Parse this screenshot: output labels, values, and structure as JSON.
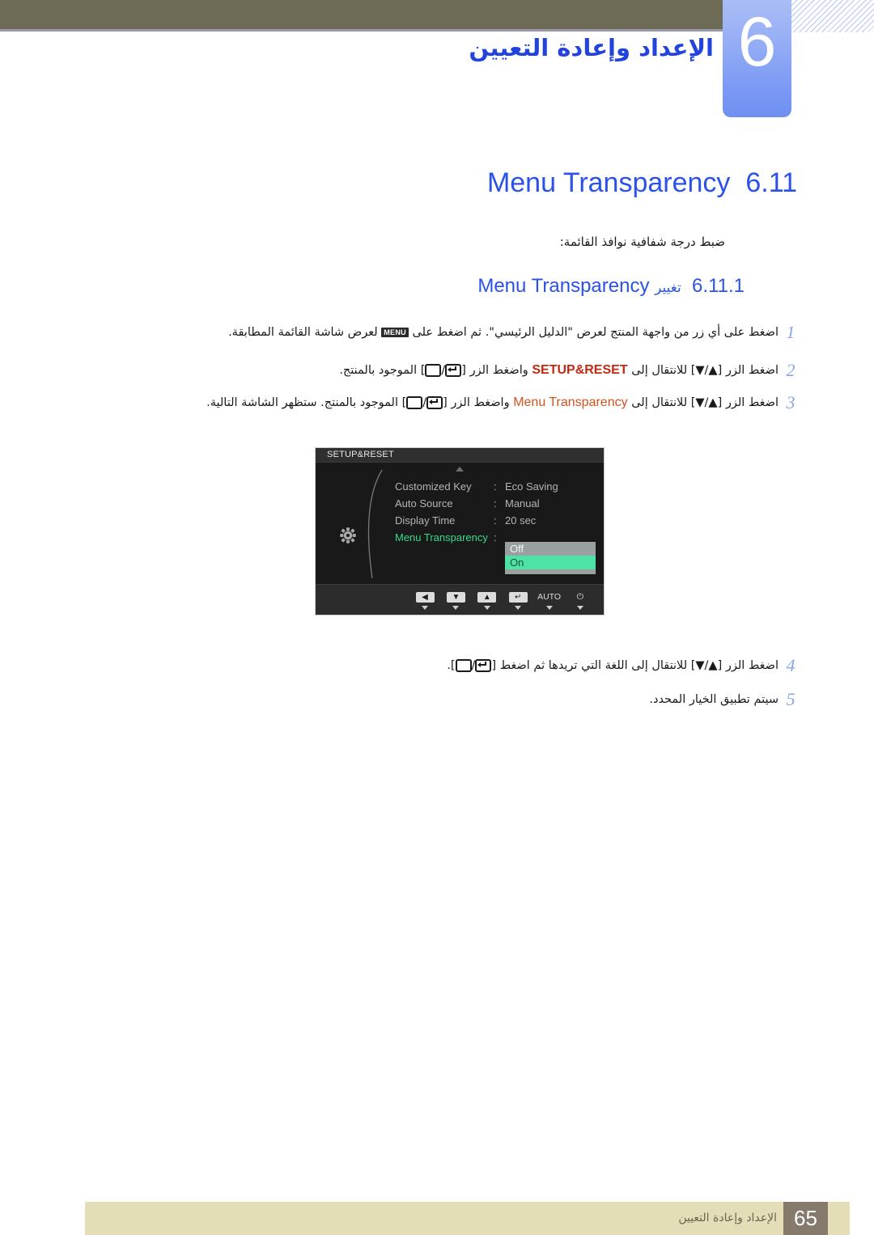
{
  "header": {
    "chapter_number": "6",
    "chapter_title": "الإعداد وإعادة التعيين"
  },
  "section": {
    "number": "6.11",
    "title_en": "Menu Transparency",
    "description": "ضبط درجة شفافية نوافذ القائمة:"
  },
  "subsection": {
    "number": "6.11.1",
    "label_ar": "تغيير",
    "title_en": "Menu Transparency"
  },
  "steps": [
    {
      "num": "1",
      "parts": [
        {
          "type": "text",
          "value": "اضغط على أي زر من واجهة المنتج لعرض \"الدليل الرئيسي\". ثم اضغط على "
        },
        {
          "type": "chip",
          "value": "MENU"
        },
        {
          "type": "text",
          "value": " لعرض شاشة القائمة المطابقة."
        }
      ]
    },
    {
      "num": "2",
      "parts": [
        {
          "type": "text",
          "value": "اضغط الزر [▲/▼] للانتقال إلى "
        },
        {
          "type": "kw-red",
          "value": "SETUP&RESET"
        },
        {
          "type": "text",
          "value": " واضغط الزر ["
        },
        {
          "type": "glyph-enter",
          "value": "enter-box"
        },
        {
          "type": "text",
          "value": "/"
        },
        {
          "type": "glyph-box",
          "value": "plain-box"
        },
        {
          "type": "text",
          "value": "] الموجود بالمنتج."
        }
      ]
    },
    {
      "num": "3",
      "parts": [
        {
          "type": "text",
          "value": "اضغط الزر [▲/▼] للانتقال إلى "
        },
        {
          "type": "kw-orange",
          "value": "Menu Transparency"
        },
        {
          "type": "text",
          "value": " واضغط الزر ["
        },
        {
          "type": "glyph-enter",
          "value": "enter-box"
        },
        {
          "type": "text",
          "value": "/"
        },
        {
          "type": "glyph-box",
          "value": "plain-box"
        },
        {
          "type": "text",
          "value": "] الموجود بالمنتج. ستظهر الشاشة التالية."
        }
      ]
    },
    {
      "num": "4",
      "parts": [
        {
          "type": "text",
          "value": "اضغط الزر [▲/▼] للانتقال إلى اللغة التي تريدها ثم اضغط ["
        },
        {
          "type": "glyph-enter",
          "value": "enter-box"
        },
        {
          "type": "text",
          "value": "/"
        },
        {
          "type": "glyph-box",
          "value": "plain-box"
        },
        {
          "type": "text",
          "value": "]."
        }
      ]
    },
    {
      "num": "5",
      "parts": [
        {
          "type": "text",
          "value": "سيتم تطبيق الخيار المحدد."
        }
      ]
    }
  ],
  "osd": {
    "title": "SETUP&RESET",
    "rows": [
      {
        "label": "Customized Key",
        "colon": ":",
        "value": "Eco Saving",
        "active": false
      },
      {
        "label": "Auto Source",
        "colon": ":",
        "value": "Manual",
        "active": false
      },
      {
        "label": "Display Time",
        "colon": ":",
        "value": "20 sec",
        "active": false
      },
      {
        "label": "Menu Transparency",
        "colon": ":",
        "value": "",
        "active": true
      }
    ],
    "dropdown": {
      "options": [
        "Off",
        "On"
      ],
      "selected": "On"
    },
    "buttons": [
      {
        "name": "left-arrow-button",
        "glyph": "◀",
        "style": "key"
      },
      {
        "name": "down-arrow-button",
        "glyph": "▼",
        "style": "key"
      },
      {
        "name": "up-arrow-button",
        "glyph": "▲",
        "style": "key"
      },
      {
        "name": "enter-button",
        "glyph": "↵",
        "style": "key"
      },
      {
        "name": "auto-button",
        "glyph": "AUTO",
        "style": "plain"
      },
      {
        "name": "power-button",
        "glyph": "⏻",
        "style": "plain"
      }
    ]
  },
  "footer": {
    "page_number": "65",
    "text": "الإعداد وإعادة التعيين"
  },
  "colors": {
    "accent_blue": "#2b52e8",
    "chapter_tab": "#7e9cf4",
    "olive_bar": "#6d6a56",
    "footer_band": "#e3ddb8",
    "footer_page_box": "#867a6c",
    "osd_bg": "#191919",
    "osd_active_green": "#39d98a",
    "osd_select_green": "#4ee3a6",
    "kw_red": "#c02a12",
    "kw_orange": "#d4521e"
  }
}
